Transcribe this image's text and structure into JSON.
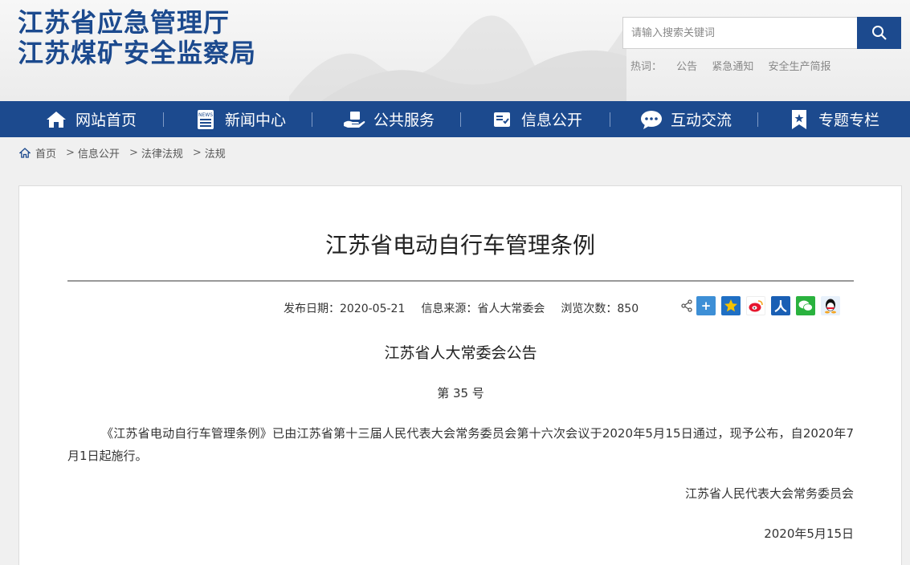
{
  "header": {
    "logo_line1": "江苏省应急管理厅",
    "logo_line2": "江苏煤矿安全监察局"
  },
  "search": {
    "placeholder": "请输入搜索关键词"
  },
  "hot": {
    "label": "热词：",
    "items": [
      "公告",
      "紧急通知",
      "安全生产简报"
    ]
  },
  "nav": {
    "items": [
      {
        "label": "网站首页",
        "icon": "home-icon"
      },
      {
        "label": "新闻中心",
        "icon": "news-icon"
      },
      {
        "label": "公共服务",
        "icon": "service-icon"
      },
      {
        "label": "信息公开",
        "icon": "info-icon"
      },
      {
        "label": "互动交流",
        "icon": "chat-icon"
      },
      {
        "label": "专题专栏",
        "icon": "bookmark-icon"
      }
    ]
  },
  "breadcrumb": {
    "items": [
      "首页",
      "信息公开",
      "法律法规",
      "法规"
    ]
  },
  "article": {
    "title": "江苏省电动自行车管理条例",
    "publish_date": "发布日期：2020-05-21",
    "source": "信息来源：省人大常委会",
    "views": "浏览次数：850",
    "notice_title": "江苏省人大常委会公告",
    "notice_number": "第 35 号",
    "paragraph": "《江苏省电动自行车管理条例》已由江苏省第十三届人民代表大会常务委员会第十六次会议于2020年5月15日通过，现予公布，自2020年7月1日起施行。",
    "signer": "江苏省人民代表大会常务委员会",
    "sign_date": "2020年5月15日"
  },
  "share": {
    "icons": [
      "share-icon",
      "plus-share-icon",
      "qzone-icon",
      "weibo-icon",
      "renren-icon",
      "wechat-icon",
      "qq-icon"
    ]
  },
  "colors": {
    "primary": "#1c4a8e",
    "nav_bg": "#1c4a8e"
  }
}
